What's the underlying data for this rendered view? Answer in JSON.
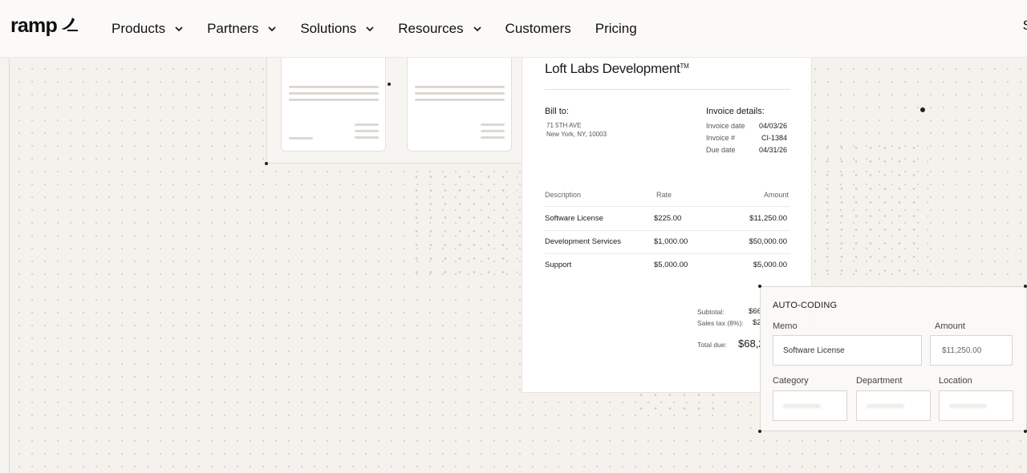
{
  "header": {
    "logo_text": "ramp",
    "nav": [
      {
        "label": "Products",
        "has_menu": true
      },
      {
        "label": "Partners",
        "has_menu": true
      },
      {
        "label": "Solutions",
        "has_menu": true
      },
      {
        "label": "Resources",
        "has_menu": true
      },
      {
        "label": "Customers",
        "has_menu": false
      },
      {
        "label": "Pricing",
        "has_menu": false
      }
    ],
    "edge_text": "S"
  },
  "invoice": {
    "company": "Loft Labs Development",
    "trademark": "TM",
    "bill_to_label": "Bill to:",
    "address_line1": "71 5TH AVE",
    "address_line2": "New York, NY, 10003",
    "details_label": "Invoice details:",
    "details": [
      {
        "key": "Invoice date",
        "value": "04/03/26"
      },
      {
        "key": "Invoice #",
        "value": "CI-1384"
      },
      {
        "key": "Due date",
        "value": "04/31/26"
      }
    ],
    "columns": [
      "Description",
      "Rate",
      "Amount"
    ],
    "items": [
      {
        "description": "Software License",
        "rate": "$225.00",
        "amount": "$11,250.00"
      },
      {
        "description": "Development Services",
        "rate": "$1,000.00",
        "amount": "$50,000.00"
      },
      {
        "description": "Support",
        "rate": "$5,000.00",
        "amount": "$5,000.00"
      }
    ],
    "subtotal_label": "Subtotal:",
    "subtotal_value": "$66",
    "tax_label": "Sales tax (8%):",
    "tax_value": "$2",
    "total_label": "Total due:",
    "total_value": "$68,2"
  },
  "auto_coding": {
    "title": "AUTO-CODING",
    "memo_label": "Memo",
    "memo_value": "Software License",
    "amount_label": "Amount",
    "amount_value": "$11,250.00",
    "category_label": "Category",
    "department_label": "Department",
    "location_label": "Location"
  }
}
